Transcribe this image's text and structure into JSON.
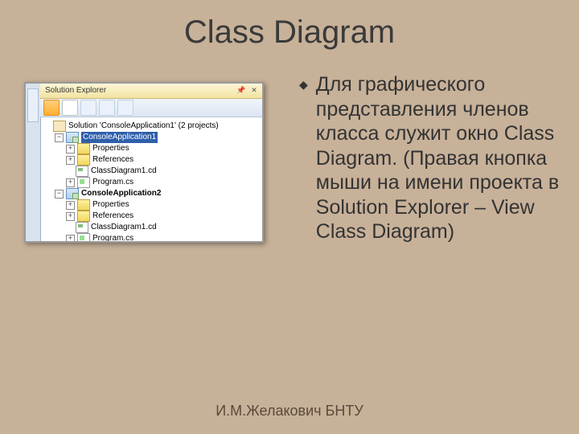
{
  "title": "Class Diagram",
  "body": "Для графического представления членов класса служит окно Class Diagram. (Правая кнопка мыши на имени проекта в Solution Explorer – View Class Diagram)",
  "footer": "И.М.Желакович БНТУ",
  "explorer": {
    "pane_title": "Solution Explorer",
    "solution": "Solution 'ConsoleApplication1' (2 projects)",
    "nodes": [
      {
        "label": "ConsoleApplication1",
        "selected": true,
        "bold": false
      },
      {
        "label": "ConsoleApplication2",
        "selected": false,
        "bold": true
      }
    ],
    "items": {
      "properties": "Properties",
      "references": "References",
      "cd": "ClassDiagram1.cd",
      "cs": "Program.cs"
    }
  }
}
